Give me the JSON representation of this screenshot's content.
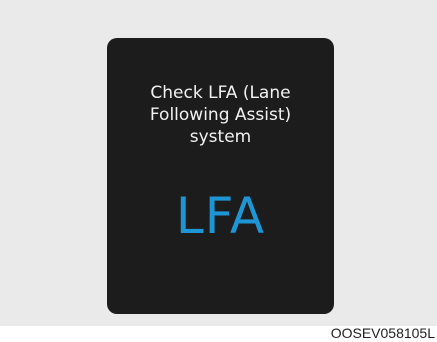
{
  "panel": {
    "message_lines": [
      "Check LFA (Lane",
      "Following Assist)",
      "system"
    ],
    "indicator_text": "LFA",
    "background_color": "#1c1c1c",
    "text_color": "#f2f2f2",
    "indicator_color": "#1e95d4"
  },
  "figure": {
    "code": "OOSEV058105L",
    "background_color": "#eaeaea"
  }
}
